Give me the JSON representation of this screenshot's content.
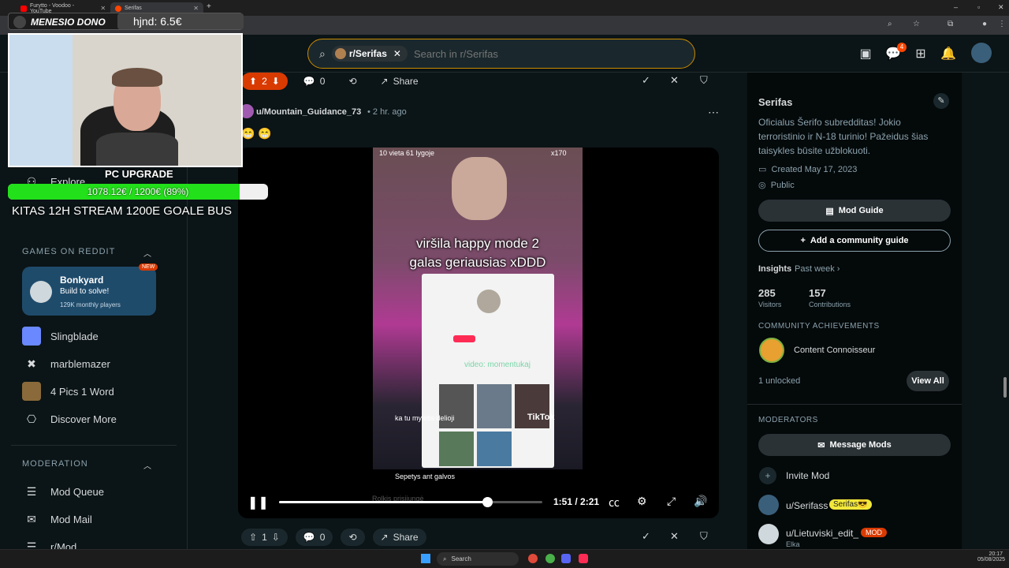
{
  "browser": {
    "tabs": [
      {
        "title": "Furytto - Voodoo - YouTube",
        "active": false
      },
      {
        "title": "Serifas",
        "active": true
      }
    ]
  },
  "overlay": {
    "donation_label": "MENESIO DONO",
    "donation_amount": "hjnd: 6.5€",
    "goal_title": "PC UPGRADE",
    "goal_progress_text": "1078.12€ / 1200€ (89%)",
    "goal_progress": 0.89,
    "ticker": "KITAS 12H STREAM 1200E GOALE BUS"
  },
  "header": {
    "subreddit_chip": "r/Serifas",
    "search_placeholder": "Search in r/Serifas",
    "notification_count": "4"
  },
  "sidebar": {
    "explore": "Explore",
    "games_title": "GAMES ON REDDIT",
    "featured_game": {
      "name": "Bonkyard",
      "tagline": "Build to solve!",
      "players": "129K monthly players",
      "badge": "NEW"
    },
    "games": [
      "Slingblade",
      "marblemazer",
      "4 Pics 1 Word",
      "Discover More"
    ],
    "moderation_title": "MODERATION",
    "moderation_items": [
      "Mod Queue",
      "Mod Mail",
      "r/Mod"
    ]
  },
  "feed": {
    "prev_post": {
      "votes": "2",
      "comments": "0",
      "share": "Share"
    },
    "post": {
      "author": "u/Mountain_Guidance_73",
      "age": "2 hr. ago",
      "body": "😁 😁",
      "video_caption_1": "viršila happy mode 2",
      "video_caption_2": "galas geriausias xDDD",
      "video_overlay_top": "10 vieta 61 lygoje",
      "video_viewers": "x170",
      "video_comment_1": "ka tu mylėtis delioji",
      "video_comment_2": "Sepetys ant galvos",
      "video_comment_3": "Rolkis prisijungė",
      "video_sub": "video: momentukaj",
      "tiktok_handle": "TikTok",
      "time": "1:51 / 2:21",
      "progress": 0.79,
      "votes": "1",
      "comments": "0",
      "share": "Share"
    }
  },
  "right": {
    "name": "Serifas",
    "description": "Oficialus Šerifo subredditas! Jokio terroristinio ir N-18 turinio! Pažeidus šias taisykles būsite užblokuoti.",
    "created": "Created May 17, 2023",
    "visibility": "Public",
    "mod_guide": "Mod Guide",
    "add_guide": "Add a community guide",
    "insights": "Insights",
    "period": "Past week",
    "visitors_value": "285",
    "visitors_label": "Visitors",
    "contrib_value": "157",
    "contrib_label": "Contributions",
    "achievements_title": "COMMUNITY ACHIEVEMENTS",
    "achievement": "Content Connoisseur",
    "unlocked": "1 unlocked",
    "view_all": "View All",
    "moderators_title": "MODERATORS",
    "message_mods": "Message Mods",
    "invite_mod": "Invite Mod",
    "mods": [
      {
        "name": "u/Serifass",
        "flair": "Serifas😎"
      },
      {
        "name": "u/Lietuviski_edit_",
        "flair": "MOD",
        "sub": "Elka"
      }
    ]
  },
  "taskbar": {
    "search": "Search",
    "time": "20:17",
    "date": "05/08/2025"
  }
}
